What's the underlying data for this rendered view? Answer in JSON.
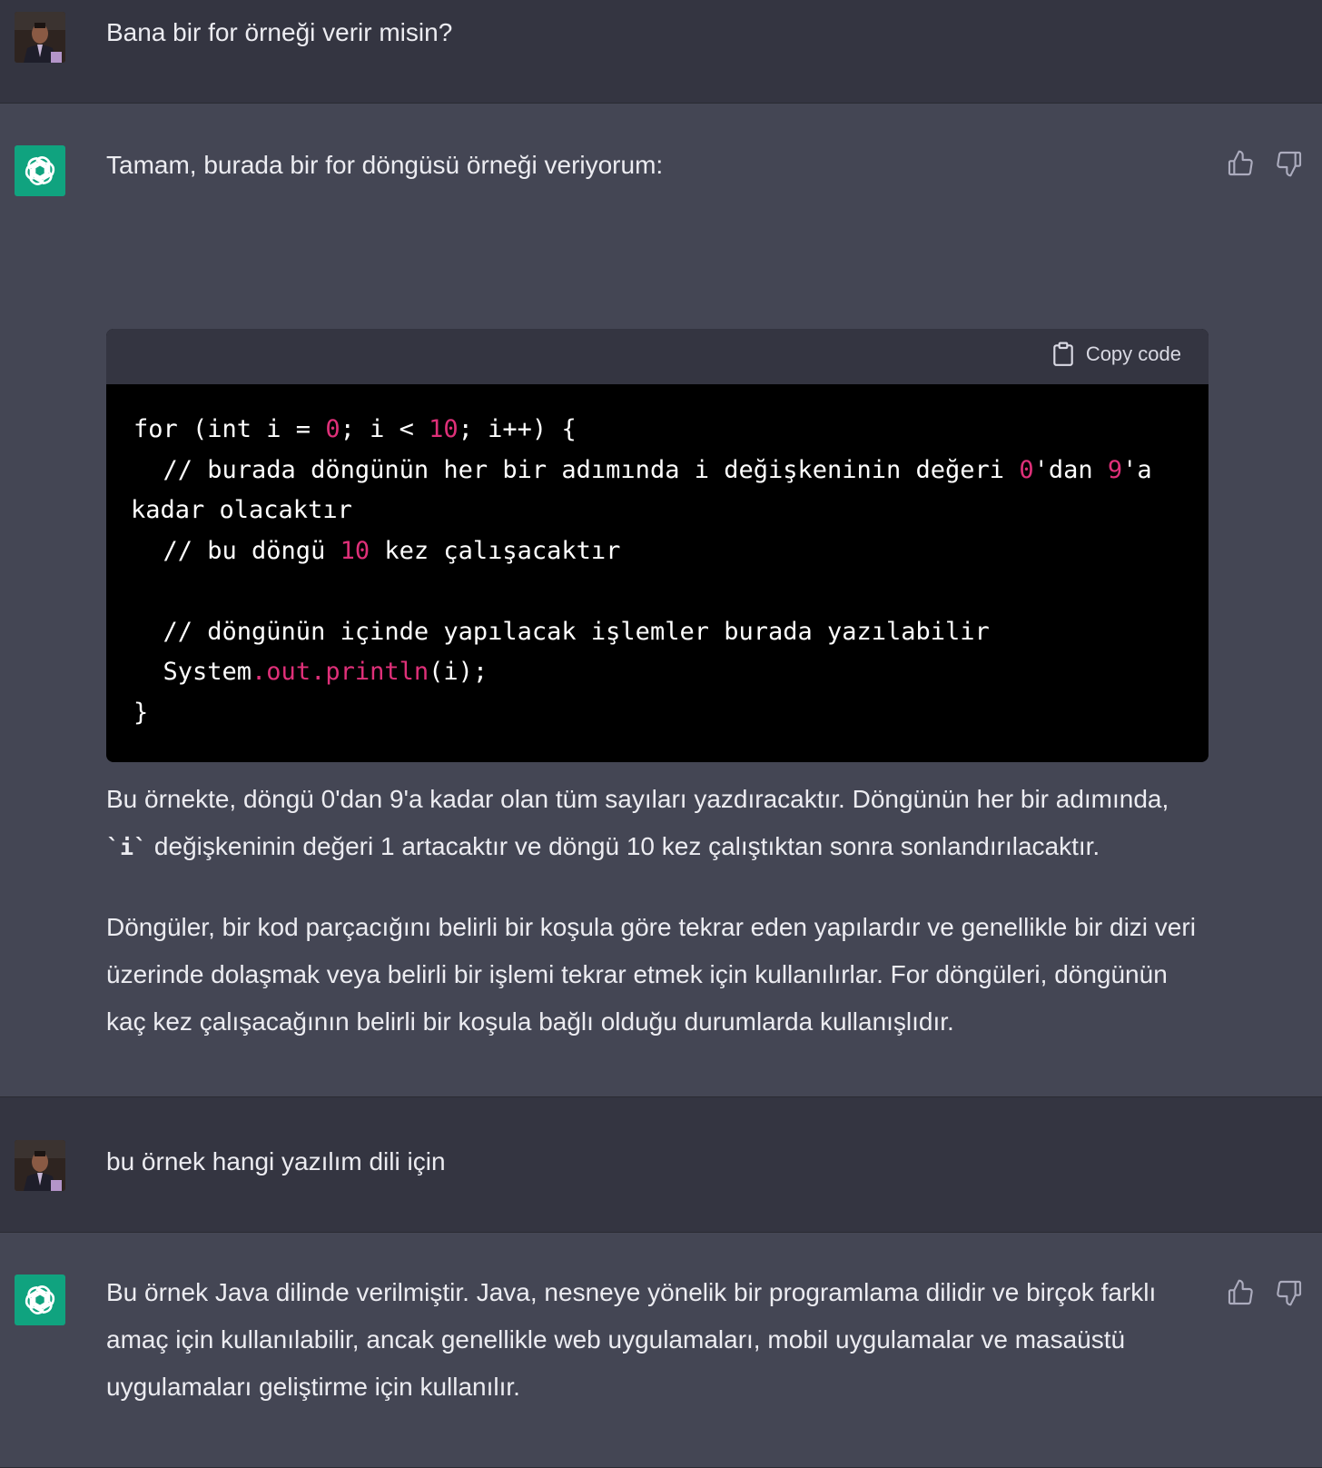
{
  "conversation": {
    "msg1": {
      "role": "user",
      "text": "Bana bir for örneği verir misin?"
    },
    "msg2": {
      "role": "assistant",
      "intro": "Tamam, burada bir for döngüsü örneği veriyorum:",
      "copy_label": "Copy code",
      "code": {
        "l1a": "for (int i = ",
        "l1n1": "0",
        "l1b": "; i < ",
        "l1n2": "10",
        "l1c": "; i++) {",
        "l2a": "  // burada döngünün her bir adımında i değişkeninin değeri ",
        "l2n1": "0",
        "l2b": "'dan ",
        "l2n2": "9",
        "l2c": "'a",
        "l3": "kadar olacaktır",
        "l4a": "  // bu döngü ",
        "l4n": "10",
        "l4b": " kez çalışacaktır",
        "l5": "",
        "l6": "  // döngünün içinde yapılacak işlemler burada yazılabilir",
        "l7a": "  System",
        "l7m": ".out.println",
        "l7b": "(i);",
        "l8": "}"
      },
      "para1_a": "Bu örnekte, döngü 0'dan 9'a kadar olan tüm sayıları yazdıracaktır. Döngünün her bir adımında, ",
      "para1_code": "`i`",
      "para1_b": " değişkeninin değeri 1 artacaktır ve döngü 10 kez çalıştıktan sonra sonlandırılacaktır.",
      "para2": "Döngüler, bir kod parçacığını belirli bir koşula göre tekrar eden yapılardır ve genellikle bir dizi veri üzerinde dolaşmak veya belirli bir işlemi tekrar etmek için kullanılırlar. For döngüleri, döngünün kaç kez çalışacağının belirli bir koşula bağlı olduğu durumlarda kullanışlıdır."
    },
    "msg3": {
      "role": "user",
      "text": "bu örnek hangi yazılım dili için"
    },
    "msg4": {
      "role": "assistant",
      "text": "Bu örnek Java dilinde verilmiştir. Java, nesneye yönelik bir programlama dilidir ve birçok farklı amaç için kullanılabilir, ancak genellikle web uygulamaları, mobil uygulamalar ve masaüstü uygulamaları geliştirme için kullanılır."
    }
  },
  "icons": {
    "user_avatar": "user-avatar-photo",
    "assistant_avatar": "openai-logo-icon",
    "like": "thumbs-up-icon",
    "dislike": "thumbs-down-icon",
    "copy": "clipboard-icon"
  },
  "colors": {
    "user_bg": "#343541",
    "assistant_bg": "#444654",
    "brand_green": "#10a37f",
    "code_bg": "#000000",
    "code_header_bg": "#343541",
    "code_number": "#df3079"
  }
}
